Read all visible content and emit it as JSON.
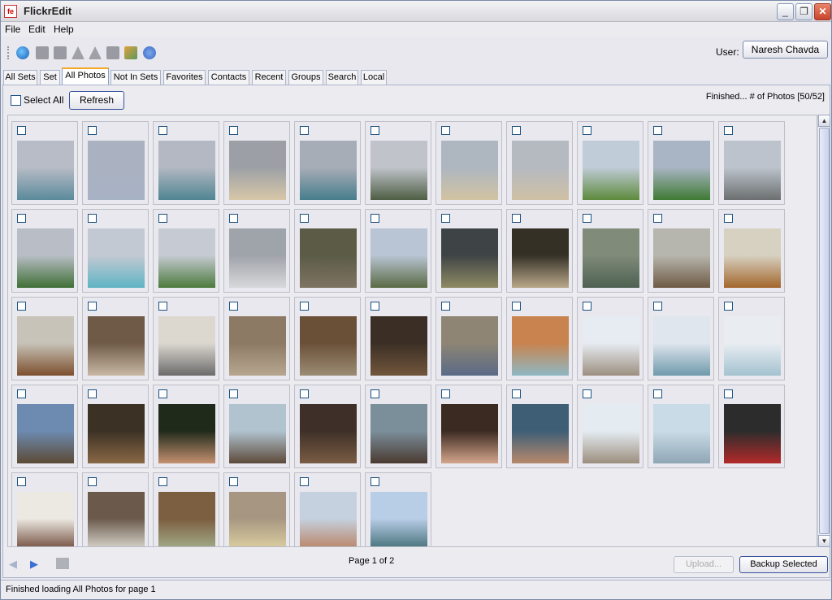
{
  "window": {
    "title": "FlickrEdit",
    "icon_text": "fe",
    "minimize": "_",
    "maximize": "❐",
    "close": "✕"
  },
  "menu": [
    "File",
    "Edit",
    "Help"
  ],
  "toolbar": {
    "icons": [
      "globe-icon",
      "upload-icon",
      "download-icon",
      "rotate-left-icon",
      "rotate-right-icon",
      "slideshow-icon",
      "sets-icon",
      "help-icon"
    ],
    "user_label": "User:",
    "user_button": "Naresh Chavda"
  },
  "tabs": [
    "All Sets",
    "Set",
    "All Photos",
    "Not In Sets",
    "Favorites",
    "Contacts",
    "Recent",
    "Groups",
    "Search",
    "Local"
  ],
  "active_tab": "All Photos",
  "controls": {
    "select_all": "Select All",
    "refresh": "Refresh",
    "status": "Finished... # of Photos [50/52]"
  },
  "photos": [
    {
      "name": "photo-01",
      "colors": [
        "#b7bcc6",
        "#5b8a9b"
      ]
    },
    {
      "name": "photo-02",
      "colors": [
        "#aab2c2",
        "#a7b2c4"
      ]
    },
    {
      "name": "photo-03",
      "colors": [
        "#b3b8c2",
        "#4f8591"
      ]
    },
    {
      "name": "photo-04",
      "colors": [
        "#9ca0a6",
        "#d8c7a8"
      ]
    },
    {
      "name": "photo-05",
      "colors": [
        "#a7adb7",
        "#477d8c"
      ]
    },
    {
      "name": "photo-06",
      "colors": [
        "#c0c3ca",
        "#4e5e44"
      ]
    },
    {
      "name": "photo-07",
      "colors": [
        "#aeb6c0",
        "#d2c3a2"
      ]
    },
    {
      "name": "photo-08",
      "colors": [
        "#b5b9c0",
        "#cfc0a4"
      ]
    },
    {
      "name": "photo-09",
      "colors": [
        "#c0ccd8",
        "#5d8a3c"
      ]
    },
    {
      "name": "photo-10",
      "colors": [
        "#a9b5c4",
        "#3f7a33"
      ]
    },
    {
      "name": "photo-11",
      "colors": [
        "#bcc3cc",
        "#6b6f6f"
      ]
    },
    {
      "name": "photo-12",
      "colors": [
        "#b9bec6",
        "#3f6f36"
      ]
    },
    {
      "name": "photo-13",
      "colors": [
        "#c3c9d2",
        "#5fb4c4"
      ]
    },
    {
      "name": "photo-14",
      "colors": [
        "#c6cbd3",
        "#4c7a3c"
      ]
    },
    {
      "name": "photo-15",
      "colors": [
        "#9fa3aa",
        "#d7d8da"
      ]
    },
    {
      "name": "photo-16",
      "colors": [
        "#5b5b46",
        "#7e7462"
      ]
    },
    {
      "name": "photo-17",
      "colors": [
        "#b9c5d4",
        "#5a6a44"
      ]
    },
    {
      "name": "photo-18",
      "colors": [
        "#3e4446",
        "#8f8a64"
      ]
    },
    {
      "name": "photo-19",
      "colors": [
        "#343026",
        "#b9a98a"
      ]
    },
    {
      "name": "photo-20",
      "colors": [
        "#808b7a",
        "#4e6152"
      ]
    },
    {
      "name": "photo-21",
      "colors": [
        "#b7b6ae",
        "#6f5a44"
      ]
    },
    {
      "name": "photo-22",
      "colors": [
        "#d7d1c2",
        "#a3662c"
      ]
    },
    {
      "name": "photo-23",
      "colors": [
        "#c7c3b8",
        "#7d4f2e"
      ]
    },
    {
      "name": "photo-24",
      "colors": [
        "#6f5a48",
        "#c8b8a4"
      ]
    },
    {
      "name": "photo-25",
      "colors": [
        "#dcd8d0",
        "#6b6b6b"
      ]
    },
    {
      "name": "photo-26",
      "colors": [
        "#8c7a64",
        "#b7a690"
      ]
    },
    {
      "name": "photo-27",
      "colors": [
        "#6b5038",
        "#9c8c74"
      ]
    },
    {
      "name": "photo-28",
      "colors": [
        "#3b2f25",
        "#71563c"
      ]
    },
    {
      "name": "photo-29",
      "colors": [
        "#8e8574",
        "#5a6a86"
      ]
    },
    {
      "name": "photo-30",
      "colors": [
        "#c8834e",
        "#8fb8c4"
      ]
    },
    {
      "name": "photo-31",
      "colors": [
        "#e7ecf2",
        "#9c8f80"
      ]
    },
    {
      "name": "photo-32",
      "colors": [
        "#dfe6ee",
        "#6f9aab"
      ]
    },
    {
      "name": "photo-33",
      "colors": [
        "#e9edf2",
        "#a3c2cf"
      ]
    },
    {
      "name": "photo-34",
      "colors": [
        "#6d8bb0",
        "#5c4a36"
      ]
    },
    {
      "name": "photo-35",
      "colors": [
        "#3b3124",
        "#8a6846"
      ]
    },
    {
      "name": "photo-36",
      "colors": [
        "#1f2a1a",
        "#c49070"
      ]
    },
    {
      "name": "photo-37",
      "colors": [
        "#b1c3cf",
        "#5c4a3a"
      ]
    },
    {
      "name": "photo-38",
      "colors": [
        "#3e3028",
        "#7a5c44"
      ]
    },
    {
      "name": "photo-39",
      "colors": [
        "#7b8f9b",
        "#4a3a30"
      ]
    },
    {
      "name": "photo-40",
      "colors": [
        "#3b2a22",
        "#d4a58b"
      ]
    },
    {
      "name": "photo-41",
      "colors": [
        "#3e5e76",
        "#b8896c"
      ]
    },
    {
      "name": "photo-42",
      "colors": [
        "#e4ecf2",
        "#9c8e7e"
      ]
    },
    {
      "name": "photo-43",
      "colors": [
        "#c9dbe6",
        "#8fa6b5"
      ]
    },
    {
      "name": "photo-44",
      "colors": [
        "#2c2c2c",
        "#b22a2a"
      ]
    },
    {
      "name": "photo-45",
      "colors": [
        "#ece9e3",
        "#6b4432"
      ]
    },
    {
      "name": "photo-46",
      "colors": [
        "#6b5a4c",
        "#e0ddd5"
      ]
    },
    {
      "name": "photo-47",
      "colors": [
        "#7c5e40",
        "#a4b28f"
      ]
    },
    {
      "name": "photo-48",
      "colors": [
        "#a79782",
        "#e0d2a2"
      ]
    },
    {
      "name": "photo-49",
      "colors": [
        "#c5d1de",
        "#b97e5e"
      ]
    },
    {
      "name": "photo-50",
      "colors": [
        "#b8cde6",
        "#3d6a72"
      ]
    }
  ],
  "bottom": {
    "page_label": "Page 1 of 2",
    "upload": "Upload...",
    "backup": "Backup Selected"
  },
  "statusbar": {
    "text": "Finished loading All Photos for page 1"
  }
}
